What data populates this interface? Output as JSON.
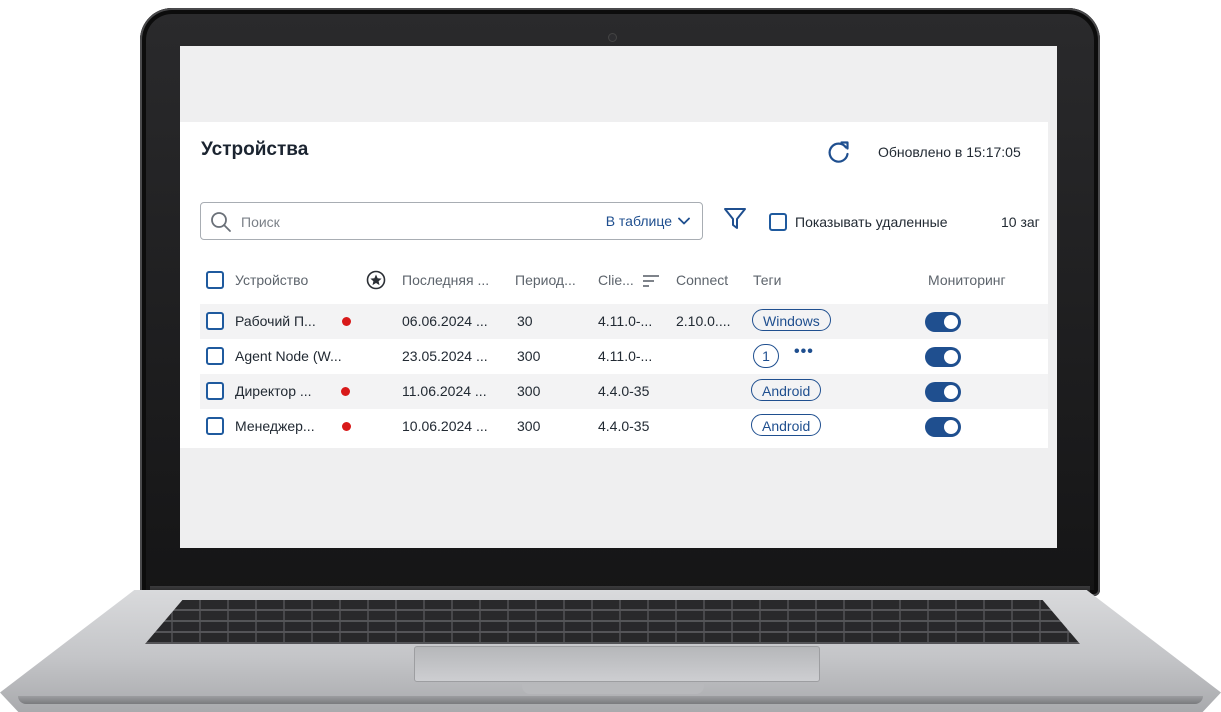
{
  "page": {
    "title": "Устройства",
    "updated": "Обновлено в 15:17:05",
    "records_count": "10 заг"
  },
  "toolbar": {
    "search_placeholder": "Поиск",
    "scope_label": "В таблице",
    "show_deleted_label": "Показывать удаленные"
  },
  "table": {
    "columns": {
      "device": "Устройство",
      "last": "Последняя ...",
      "period": "Период...",
      "client": "Clie...",
      "connect": "Connect",
      "tags": "Теги",
      "monitoring": "Мониторинг"
    },
    "rows": [
      {
        "device": "Рабочий П...",
        "alert": true,
        "last": "06.06.2024 ...",
        "period": "30",
        "client": "4.11.0-...",
        "connect": "2.10.0....",
        "tags": [
          "Windows"
        ],
        "tag_count": null,
        "monitoring": true
      },
      {
        "device": "Agent Node (W...",
        "alert": false,
        "last": "23.05.2024 ...",
        "period": "300",
        "client": "4.11.0-...",
        "connect": "",
        "tags": [],
        "tag_count": "1",
        "tag_more": "•••",
        "monitoring": true
      },
      {
        "device": "Директор ...",
        "alert": true,
        "last": "11.06.2024 ...",
        "period": "300",
        "client": "4.4.0-35",
        "connect": "",
        "tags": [
          "Android"
        ],
        "tag_count": null,
        "monitoring": true
      },
      {
        "device": "Менеджер...",
        "alert": true,
        "last": "10.06.2024 ...",
        "period": "300",
        "client": "4.4.0-35",
        "connect": "",
        "tags": [
          "Android"
        ],
        "tag_count": null,
        "monitoring": true
      }
    ]
  },
  "colors": {
    "accent": "#1f4f8f",
    "alert": "#d81919",
    "stripe": "#f3f3f4"
  },
  "icons": [
    "refresh-icon",
    "search-icon",
    "chevron-down-icon",
    "filter-icon",
    "star-icon"
  ]
}
